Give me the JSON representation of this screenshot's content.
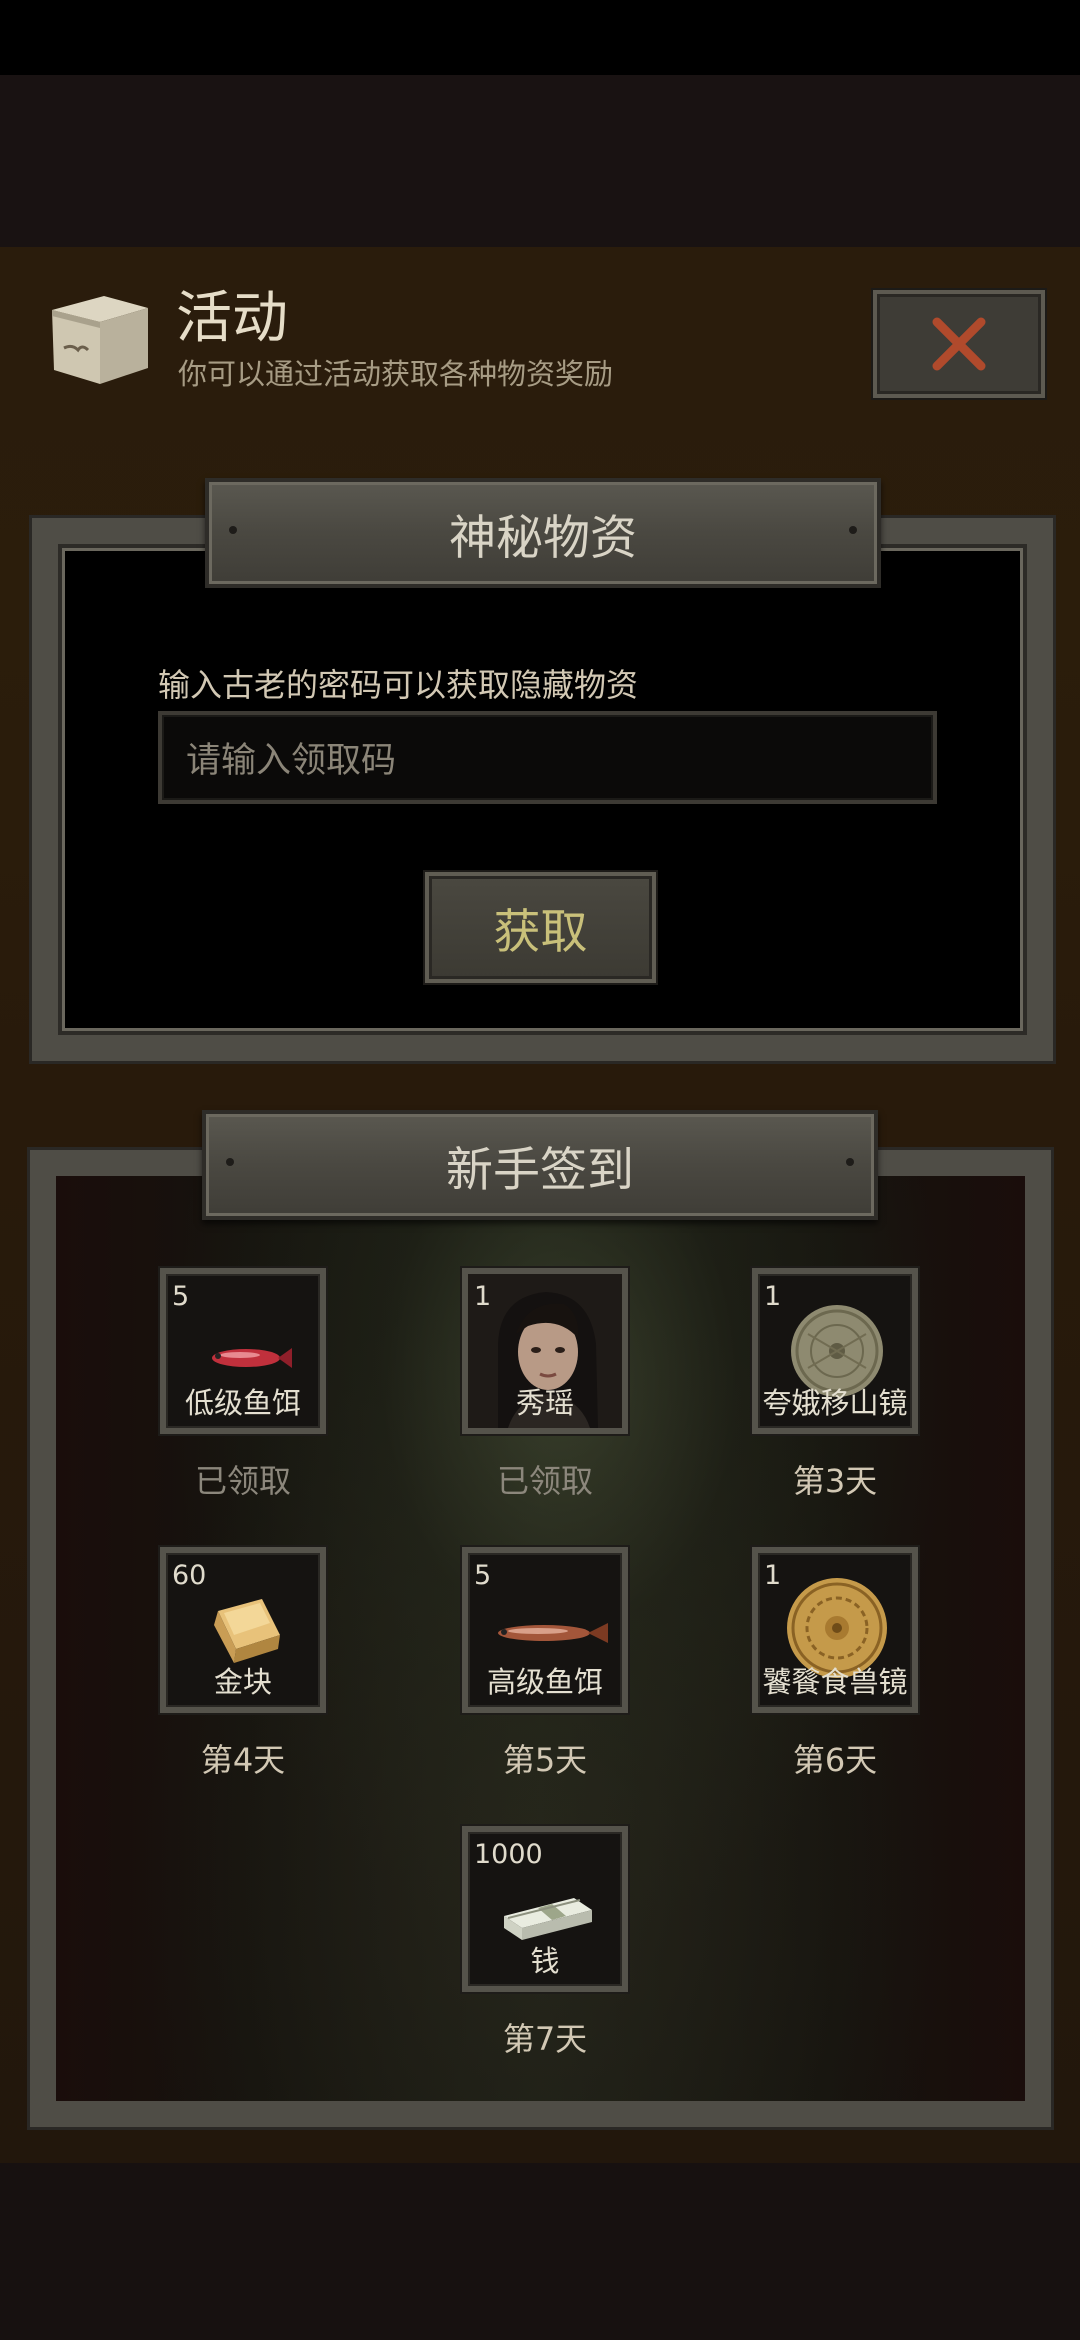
{
  "header": {
    "title": "活动",
    "subtitle": "你可以通过活动获取各种物资奖励",
    "icon": "box-icon",
    "close_icon": "close-icon"
  },
  "mystery": {
    "banner": "神秘物资",
    "hint": "输入古老的密码可以获取隐藏物资",
    "placeholder": "请输入领取码",
    "button": "获取"
  },
  "signin": {
    "banner": "新手签到",
    "rewards": [
      {
        "qty": "5",
        "name": "低级鱼饵",
        "day": "已领取",
        "claimed": true,
        "icon": "low-bait-icon"
      },
      {
        "qty": "1",
        "name": "秀瑶",
        "day": "已领取",
        "claimed": true,
        "icon": "portrait-xiuyao"
      },
      {
        "qty": "1",
        "name": "夸娥移山镜",
        "day": "第3天",
        "claimed": false,
        "icon": "bronze-mirror-icon"
      },
      {
        "qty": "60",
        "name": "金块",
        "day": "第4天",
        "claimed": false,
        "icon": "gold-bar-icon"
      },
      {
        "qty": "5",
        "name": "高级鱼饵",
        "day": "第5天",
        "claimed": false,
        "icon": "high-bait-icon"
      },
      {
        "qty": "1",
        "name": "饕餮食兽镜",
        "day": "第6天",
        "claimed": false,
        "icon": "golden-mirror-icon"
      },
      {
        "qty": "1000",
        "name": "钱",
        "day": "第7天",
        "claimed": false,
        "icon": "money-stack-icon"
      }
    ]
  },
  "colors": {
    "accent_button_text": "#c9c07a",
    "frame": "#4f4d46",
    "claimed_text": "#8c877c"
  }
}
